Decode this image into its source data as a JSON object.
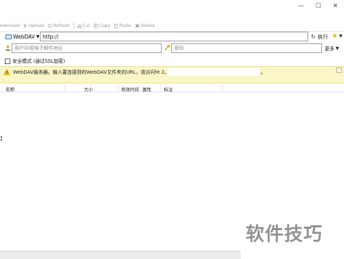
{
  "window": {
    "controls": {
      "minimize": "—",
      "maximize": "☐",
      "close": "✕"
    }
  },
  "toolbar": {
    "download": "Download",
    "upload": "Upload",
    "refresh": "Refresh",
    "cut": "Cut",
    "copy": "Copy",
    "paste": "Paste",
    "delete": "Delete"
  },
  "address": {
    "protocol": "WebDAV",
    "url_value": "http://",
    "execute_label": "执行"
  },
  "credentials": {
    "user_placeholder": "用户ID或电子邮件地址",
    "password_placeholder": "密码",
    "more_label": "更多"
  },
  "secure_mode": {
    "label": "安全模式 (通过SSL加密)",
    "checked": false
  },
  "info_banner": {
    "text": "WebDAV服务器。输入要连接到的WebDAV文件夹的URL，请访问ht                                                                                         2。输入用户名和密码以对服务器进行身份验证。"
  },
  "file_list": {
    "columns": [
      "名称",
      "大小",
      "修改时间",
      "属性",
      "标注"
    ]
  },
  "watermark": "软件技巧",
  "colors": {
    "banner_bg": "#fbf6c7",
    "toolbar_disabled": "#9a9a9a",
    "star": "#f2b01e"
  }
}
